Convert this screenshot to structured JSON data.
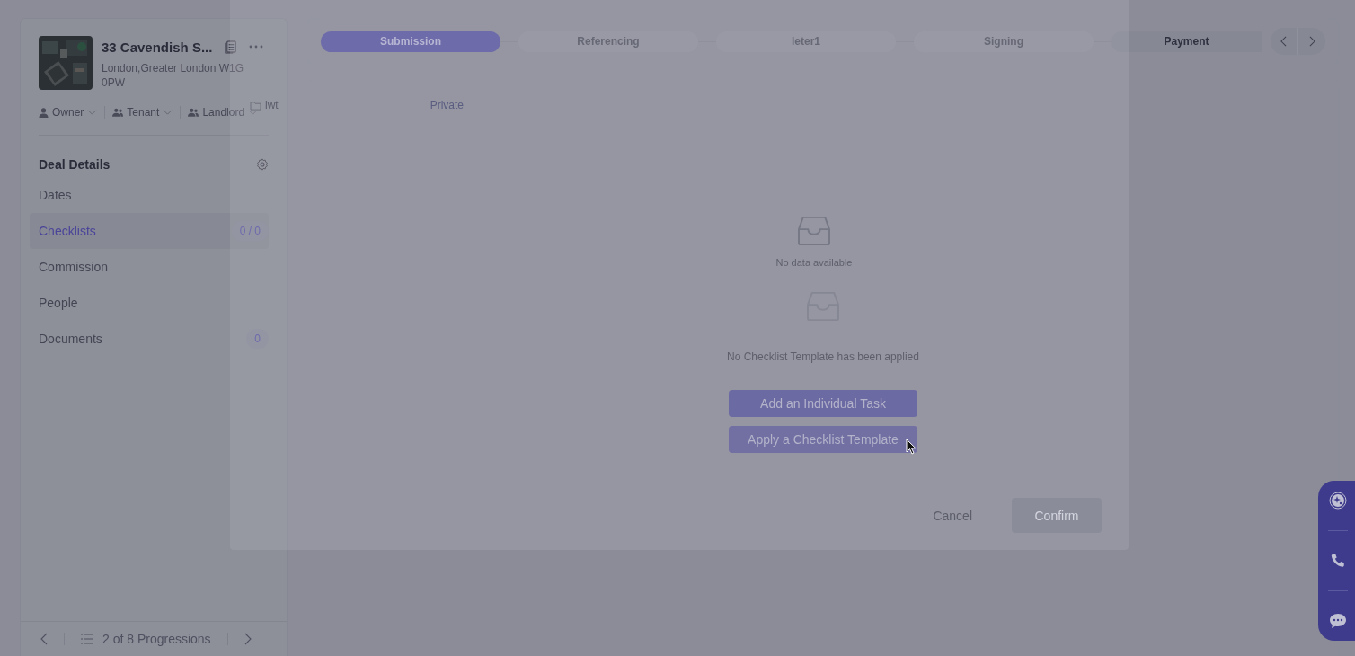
{
  "deal": {
    "title": "33 Cavendish S...",
    "address": "London,Greater London W1G 0PW"
  },
  "roles": [
    {
      "label": "Owner",
      "kind": "single"
    },
    {
      "label": "Tenant",
      "kind": "group"
    },
    {
      "label": "Landlord",
      "kind": "group"
    }
  ],
  "sidebar": {
    "heading": "Deal Details",
    "items": [
      {
        "label": "Dates",
        "selected": false
      },
      {
        "label": "Checklists",
        "selected": true,
        "badge": "0 / 0"
      },
      {
        "label": "Commission",
        "selected": false
      },
      {
        "label": "People",
        "selected": false
      },
      {
        "label": "Documents",
        "selected": false,
        "badge": "0"
      }
    ]
  },
  "pager": {
    "text": "2 of 8 Progressions"
  },
  "stages": [
    {
      "label": "Submission",
      "selected": true
    },
    {
      "label": "Referencing",
      "selected": false
    },
    {
      "label": "leter1",
      "selected": false
    },
    {
      "label": "Signing",
      "selected": false
    },
    {
      "label": "Payment",
      "selected": false
    }
  ],
  "empty_state": {
    "message": "No Checklist Template has been applied",
    "buttons": [
      "Add an Individual Task",
      "Apply a Checklist Template"
    ]
  },
  "modal": {
    "folder": "lwt",
    "visibility": "Private",
    "empty_message": "No data available",
    "cancel": "Cancel",
    "confirm": "Confirm"
  }
}
